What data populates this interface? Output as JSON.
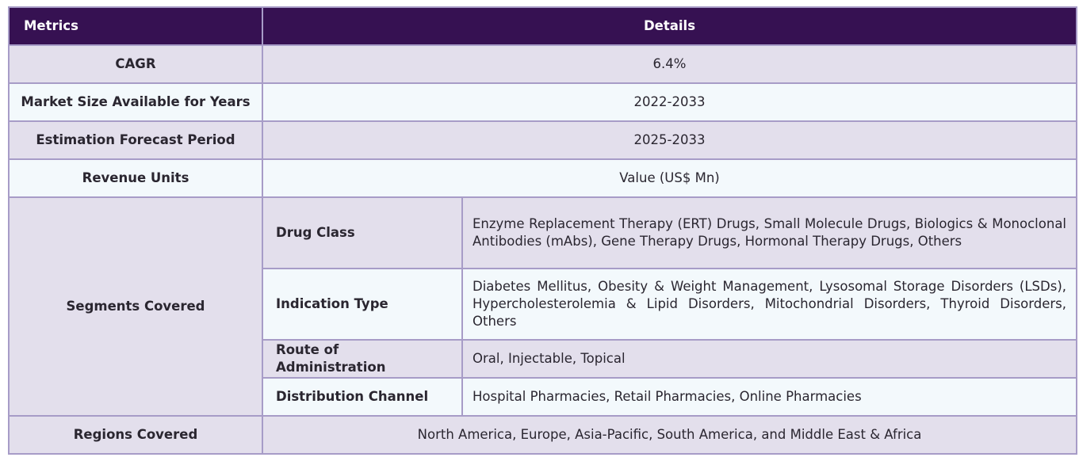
{
  "header": {
    "metrics_label": "Metrics",
    "details_label": "Details"
  },
  "rows": [
    {
      "metric": "CAGR",
      "value": "6.4%"
    },
    {
      "metric": "Market Size Available for Years",
      "value": "2022-2033"
    },
    {
      "metric": "Estimation Forecast Period",
      "value": "2025-2033"
    },
    {
      "metric": "Revenue Units",
      "value": "Value (US$ Mn)"
    }
  ],
  "segments": {
    "label": "Segments Covered",
    "items": [
      {
        "name": "Drug Class",
        "value": "Enzyme Replacement Therapy (ERT) Drugs, Small Molecule Drugs, Biologics & Monoclonal Antibodies (mAbs), Gene Therapy Drugs, Hormonal Therapy Drugs, Others"
      },
      {
        "name": "Indication Type",
        "value": "Diabetes Mellitus, Obesity & Weight Management, Lysosomal Storage Disorders (LSDs), Hypercholesterolemia & Lipid Disorders, Mitochondrial Disorders, Thyroid Disorders, Others"
      },
      {
        "name": "Route of Administration",
        "value": "Oral, Injectable, Topical"
      },
      {
        "name": "Distribution Channel",
        "value": "Hospital Pharmacies, Retail Pharmacies, Online Pharmacies"
      }
    ]
  },
  "regions": {
    "metric": "Regions Covered",
    "value": "North America, Europe, Asia-Pacific, South America, and Middle East & Africa"
  },
  "colors": {
    "header_bg": "#361152",
    "odd_row_bg": "#e3dfec",
    "even_row_bg": "#f3f9fc",
    "border": "#a79cc7"
  }
}
